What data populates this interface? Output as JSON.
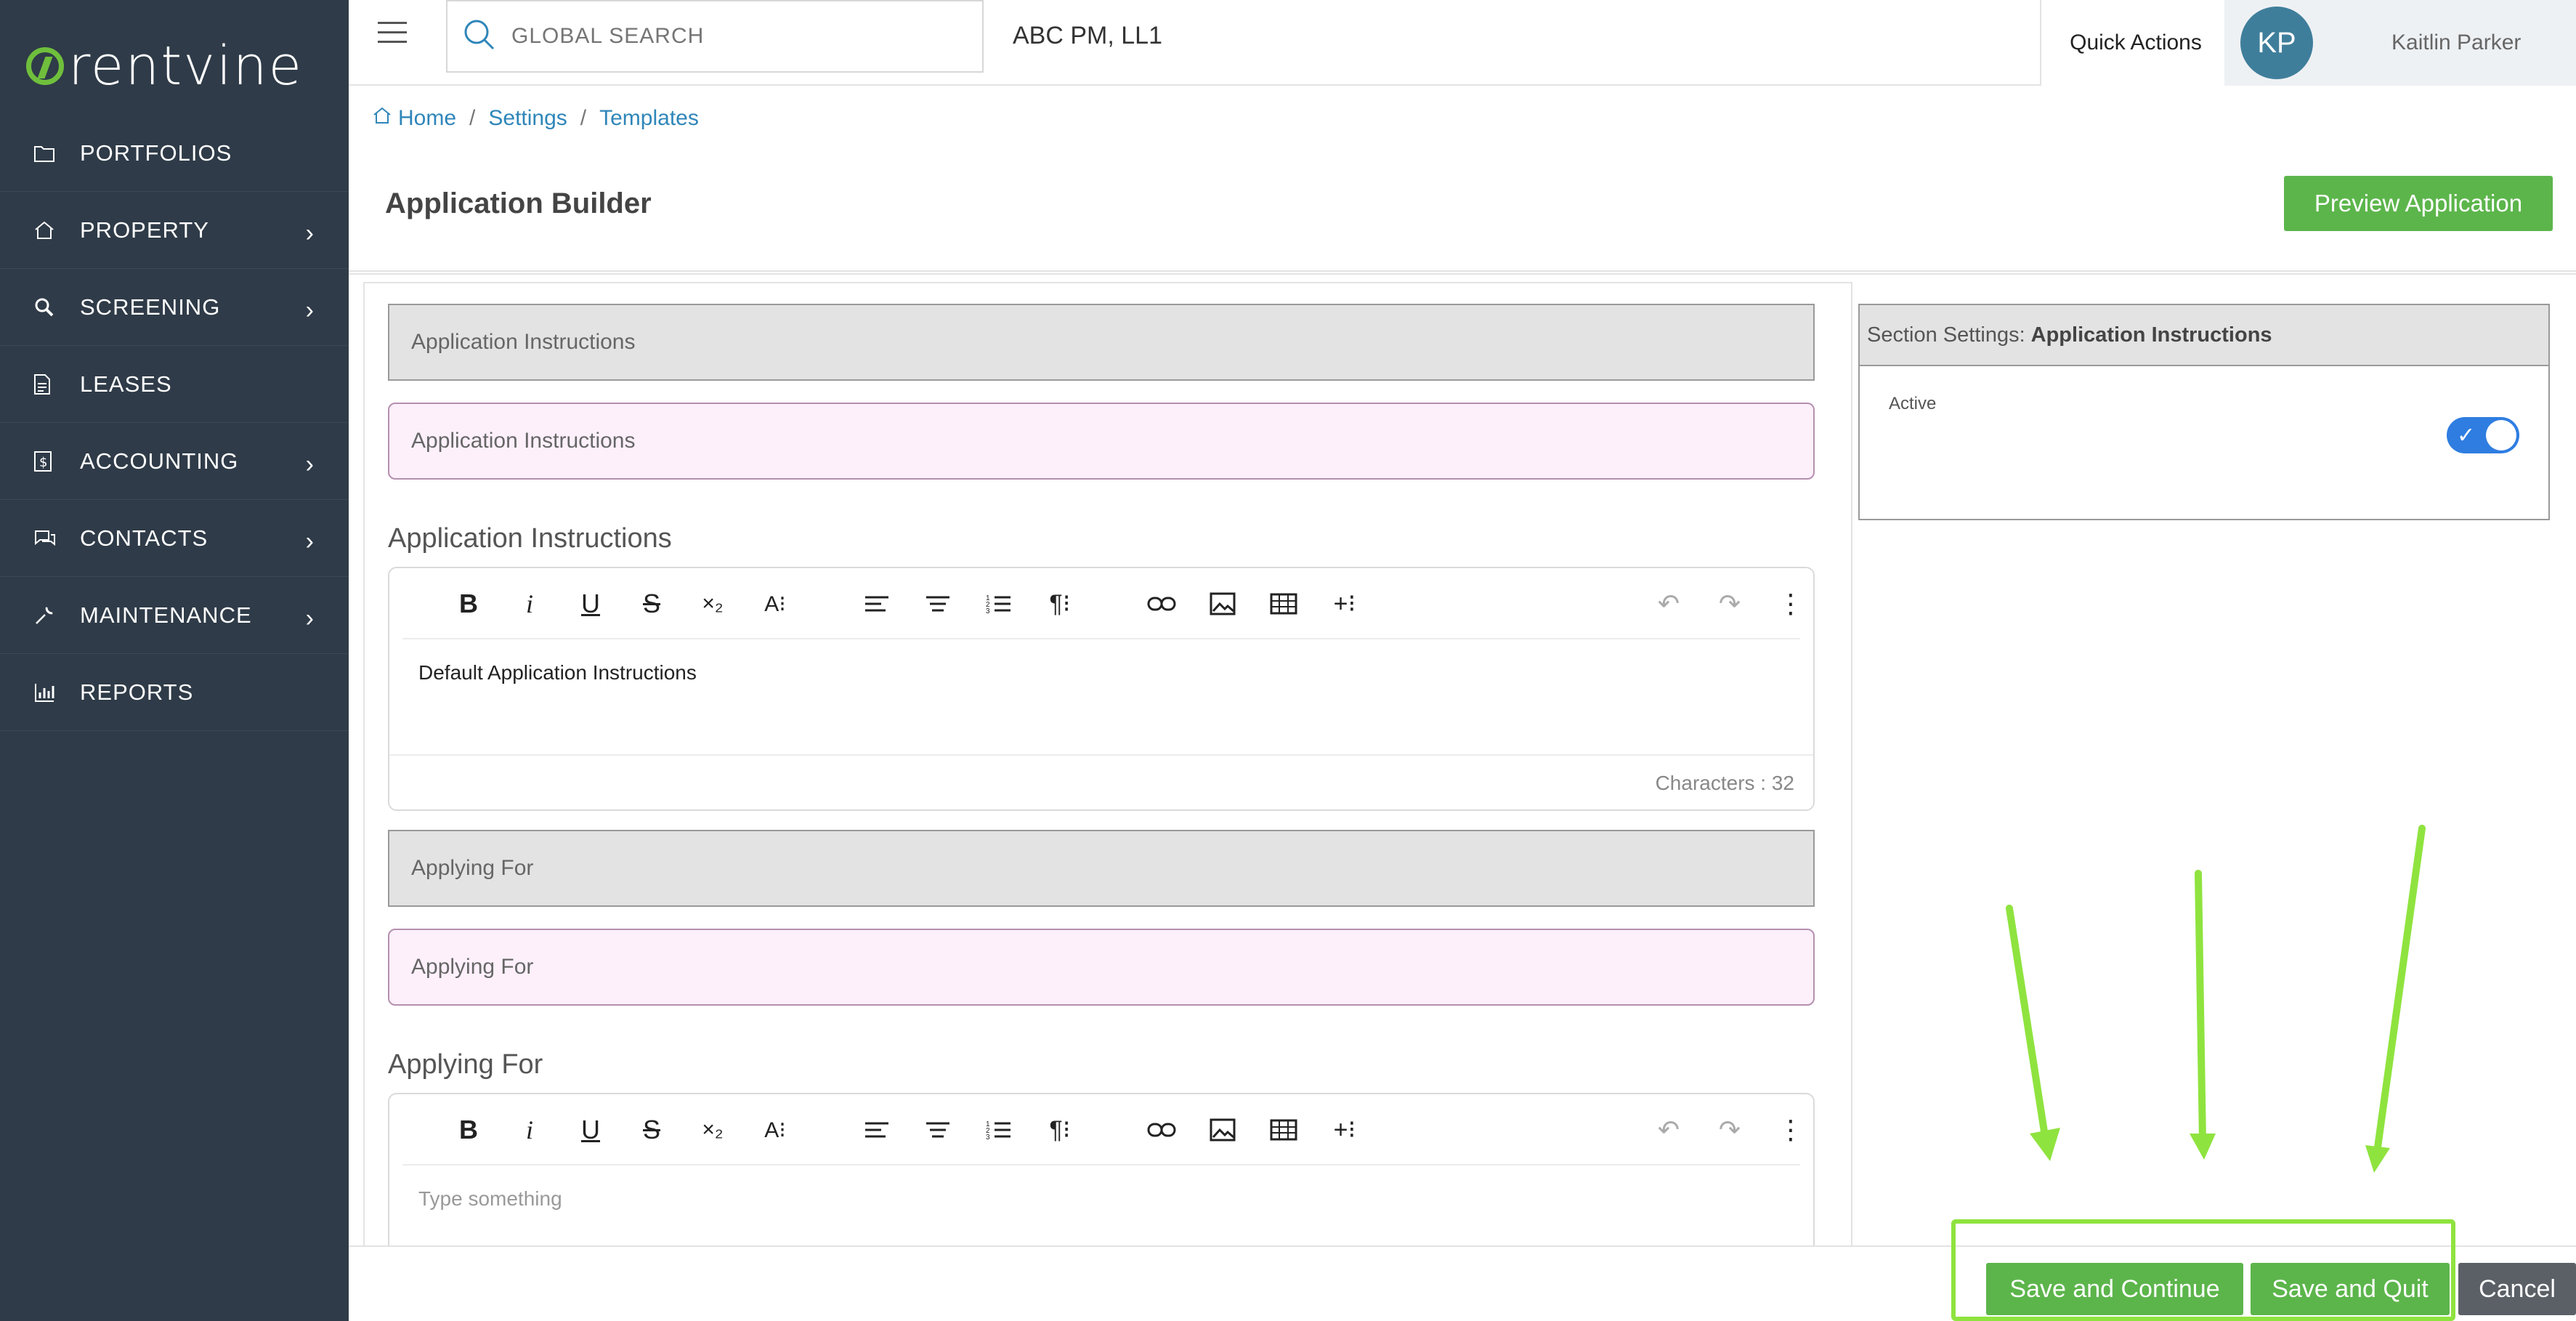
{
  "brand": {
    "logo_text": "rentvine",
    "accent_color": "#6fbf3c"
  },
  "sidebar": {
    "items": [
      {
        "label": "PORTFOLIOS",
        "icon": "folder-icon",
        "has_submenu": false
      },
      {
        "label": "PROPERTY",
        "icon": "home-icon",
        "has_submenu": true
      },
      {
        "label": "SCREENING",
        "icon": "magnify-icon",
        "has_submenu": true
      },
      {
        "label": "LEASES",
        "icon": "document-icon",
        "has_submenu": false
      },
      {
        "label": "ACCOUNTING",
        "icon": "dollar-icon",
        "has_submenu": true
      },
      {
        "label": "CONTACTS",
        "icon": "chat-icon",
        "has_submenu": true
      },
      {
        "label": "MAINTENANCE",
        "icon": "wrench-icon",
        "has_submenu": true
      },
      {
        "label": "REPORTS",
        "icon": "bar-chart-icon",
        "has_submenu": false
      }
    ]
  },
  "topbar": {
    "search_placeholder": "GLOBAL SEARCH",
    "company": "ABC PM, LL1",
    "quick_actions": "Quick Actions",
    "avatar_initials": "KP",
    "user_name": "Kaitlin Parker"
  },
  "breadcrumb": {
    "home": "Home",
    "settings": "Settings",
    "templates": "Templates"
  },
  "page": {
    "title": "Application Builder",
    "preview_button": "Preview Application"
  },
  "builder": {
    "section1": {
      "header": "Application Instructions",
      "pink_label": "Application Instructions",
      "field_title": "Application Instructions",
      "editor_text": "Default Application Instructions",
      "char_count": "Characters : 32"
    },
    "section2": {
      "header": "Applying For",
      "pink_label": "Applying For",
      "field_title": "Applying For",
      "editor_placeholder": "Type something"
    }
  },
  "settings": {
    "prefix": "Section Settings:",
    "section_name": "Application Instructions",
    "active_label": "Active",
    "active_value": true
  },
  "footer": {
    "save_continue": "Save and Continue",
    "save_quit": "Save and Quit",
    "cancel": "Cancel"
  },
  "colors": {
    "green_button": "#5cb54b",
    "sidebar_bg": "#2f3b48",
    "link": "#2f86b9",
    "highlight": "#8fe33f"
  }
}
